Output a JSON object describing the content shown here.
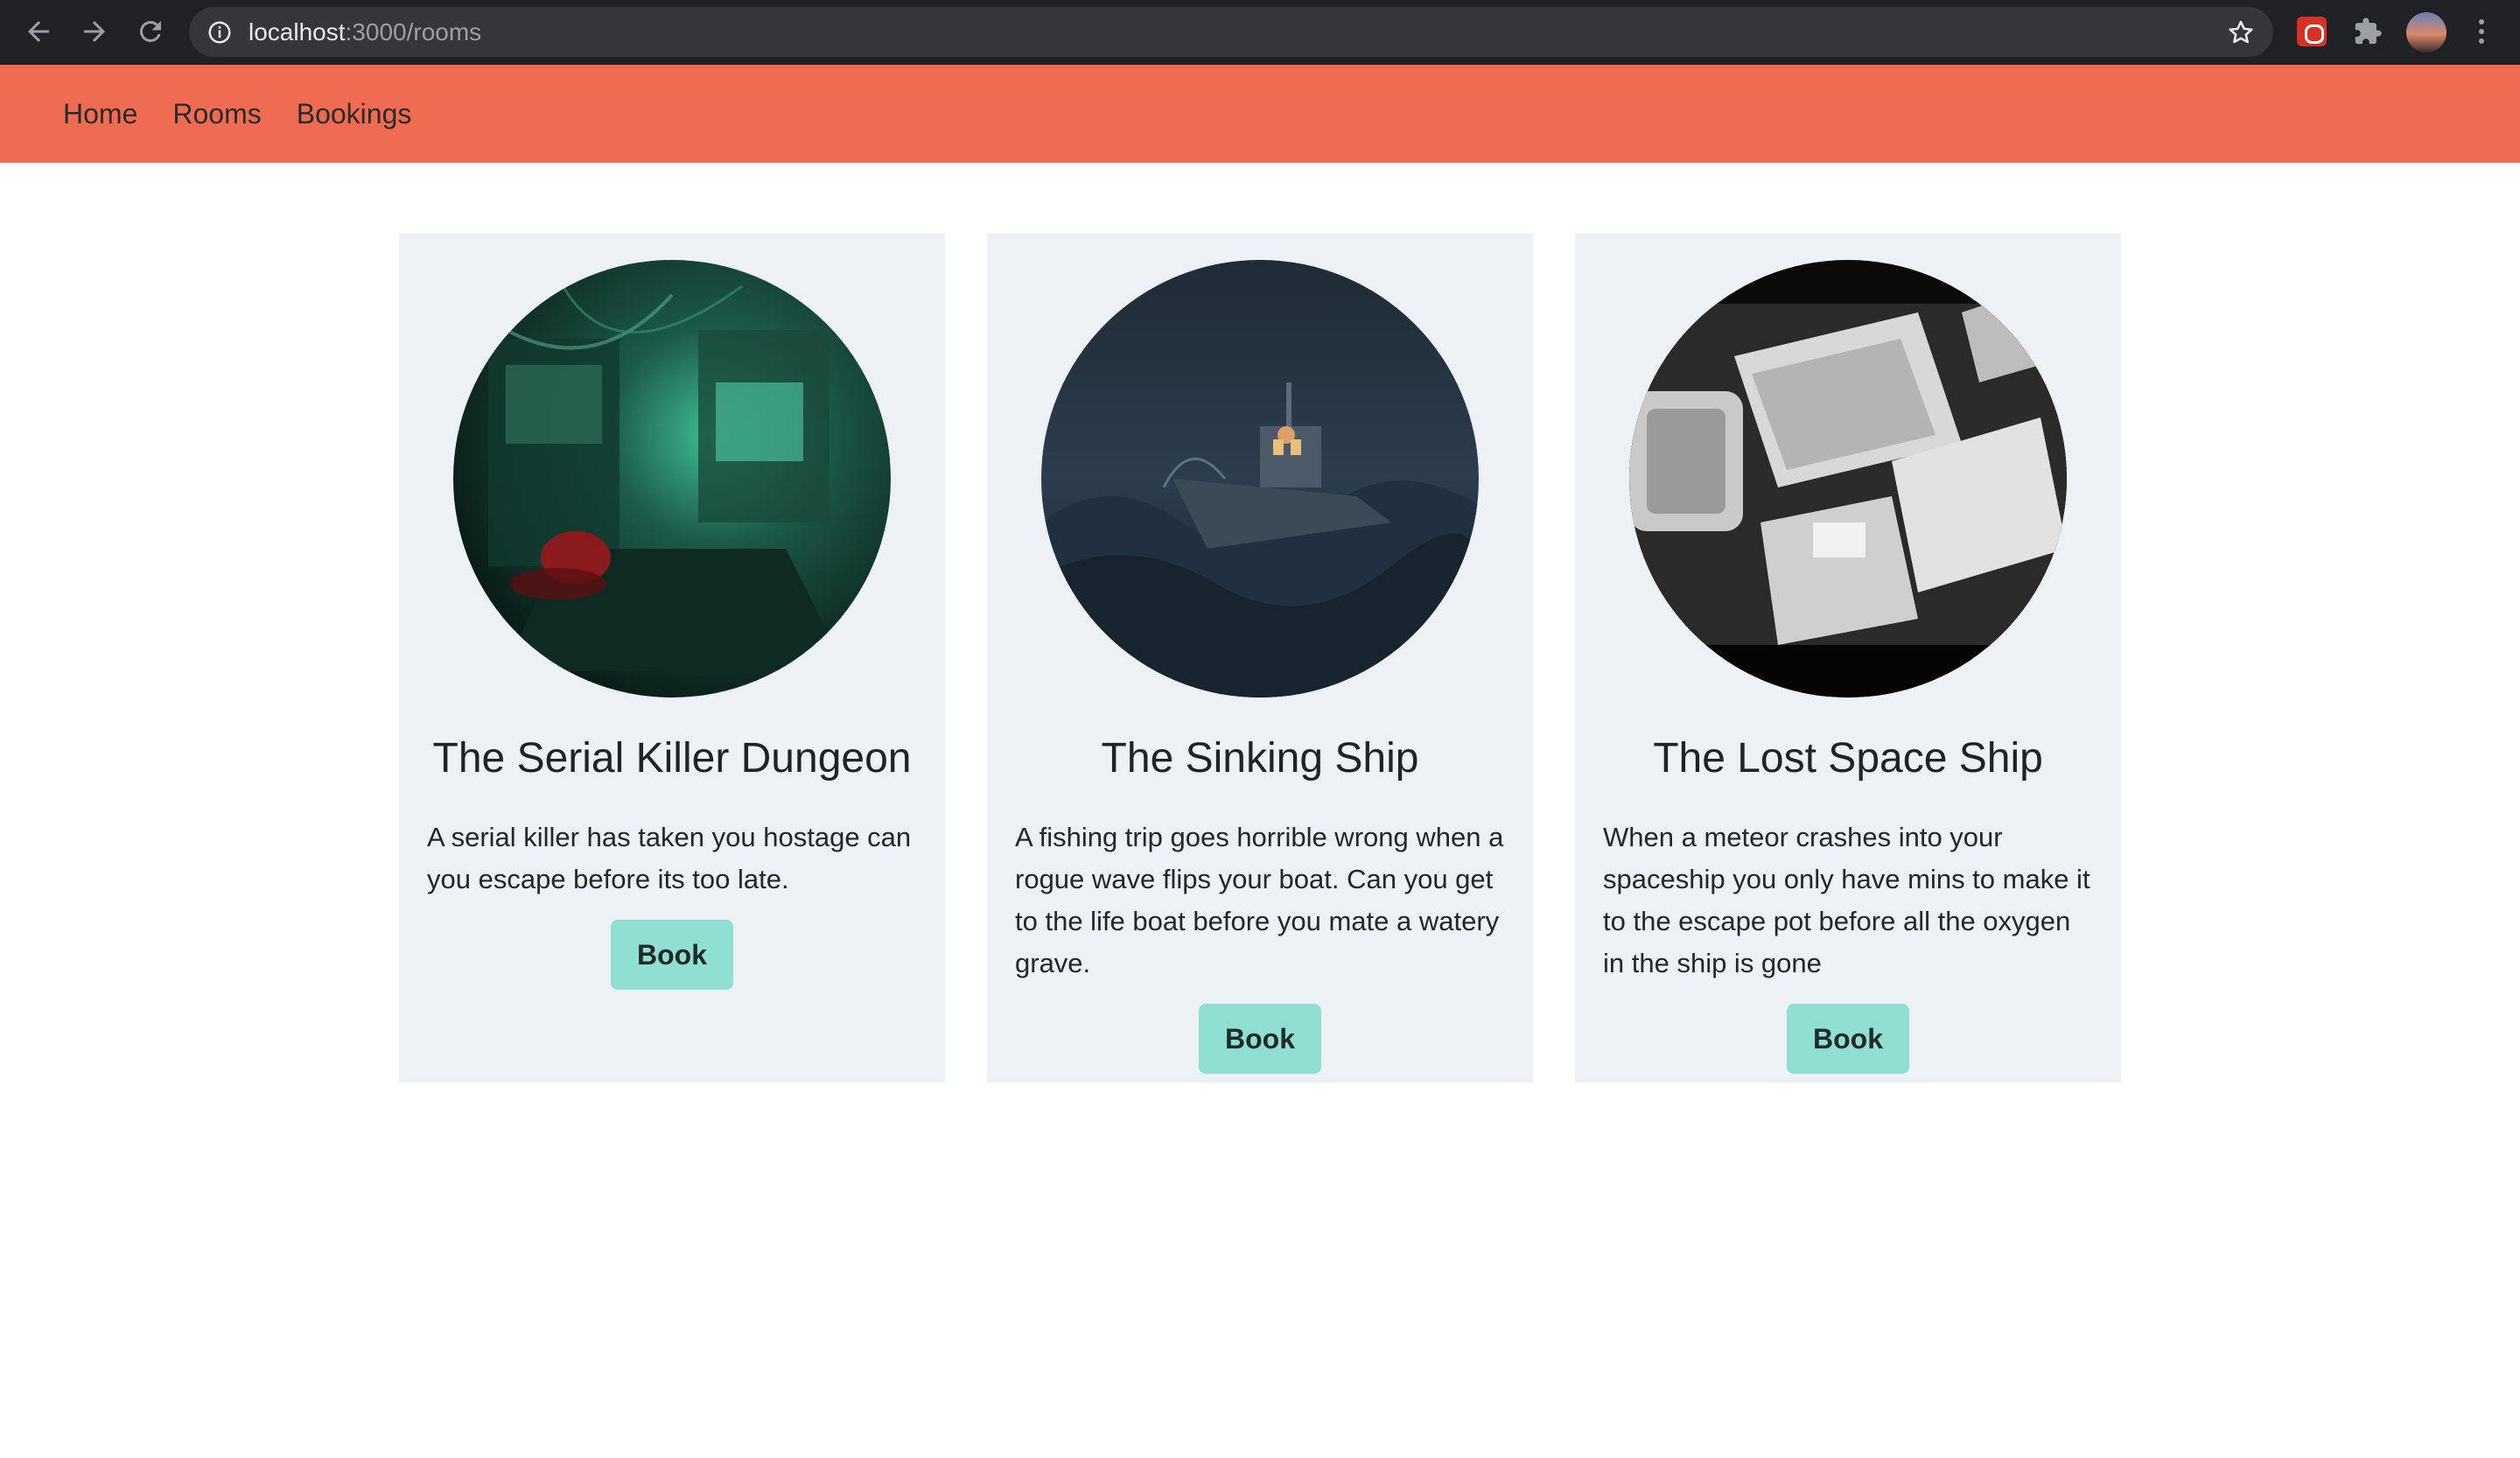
{
  "browser": {
    "url_host": "localhost",
    "url_path": ":3000/rooms",
    "icons": [
      "back-arrow-icon",
      "forward-arrow-icon",
      "reload-icon",
      "info-icon",
      "star-icon",
      "extension-icon",
      "puzzle-icon",
      "avatar",
      "more-vert-icon"
    ]
  },
  "navbar": {
    "items": [
      {
        "label": "Home"
      },
      {
        "label": "Rooms"
      },
      {
        "label": "Bookings"
      }
    ],
    "background": "#ef6c53"
  },
  "rooms": [
    {
      "title": "The Serial Killer Dungeon",
      "description": "A serial killer has taken you hostage can you escape before its too late.",
      "button_label": "Book"
    },
    {
      "title": "The Sinking Ship",
      "description": "A fishing trip goes horrible wrong when a rogue wave flips your boat. Can you get to the life boat before you mate a watery grave.",
      "button_label": "Book"
    },
    {
      "title": "The Lost Space Ship",
      "description": "When a meteor crashes into your spaceship you only have mins to make it to the escape pot before all the oxygen in the ship is gone",
      "button_label": "Book"
    }
  ],
  "colors": {
    "card_background": "#edf0f5",
    "button_background": "#8fe0d2"
  }
}
